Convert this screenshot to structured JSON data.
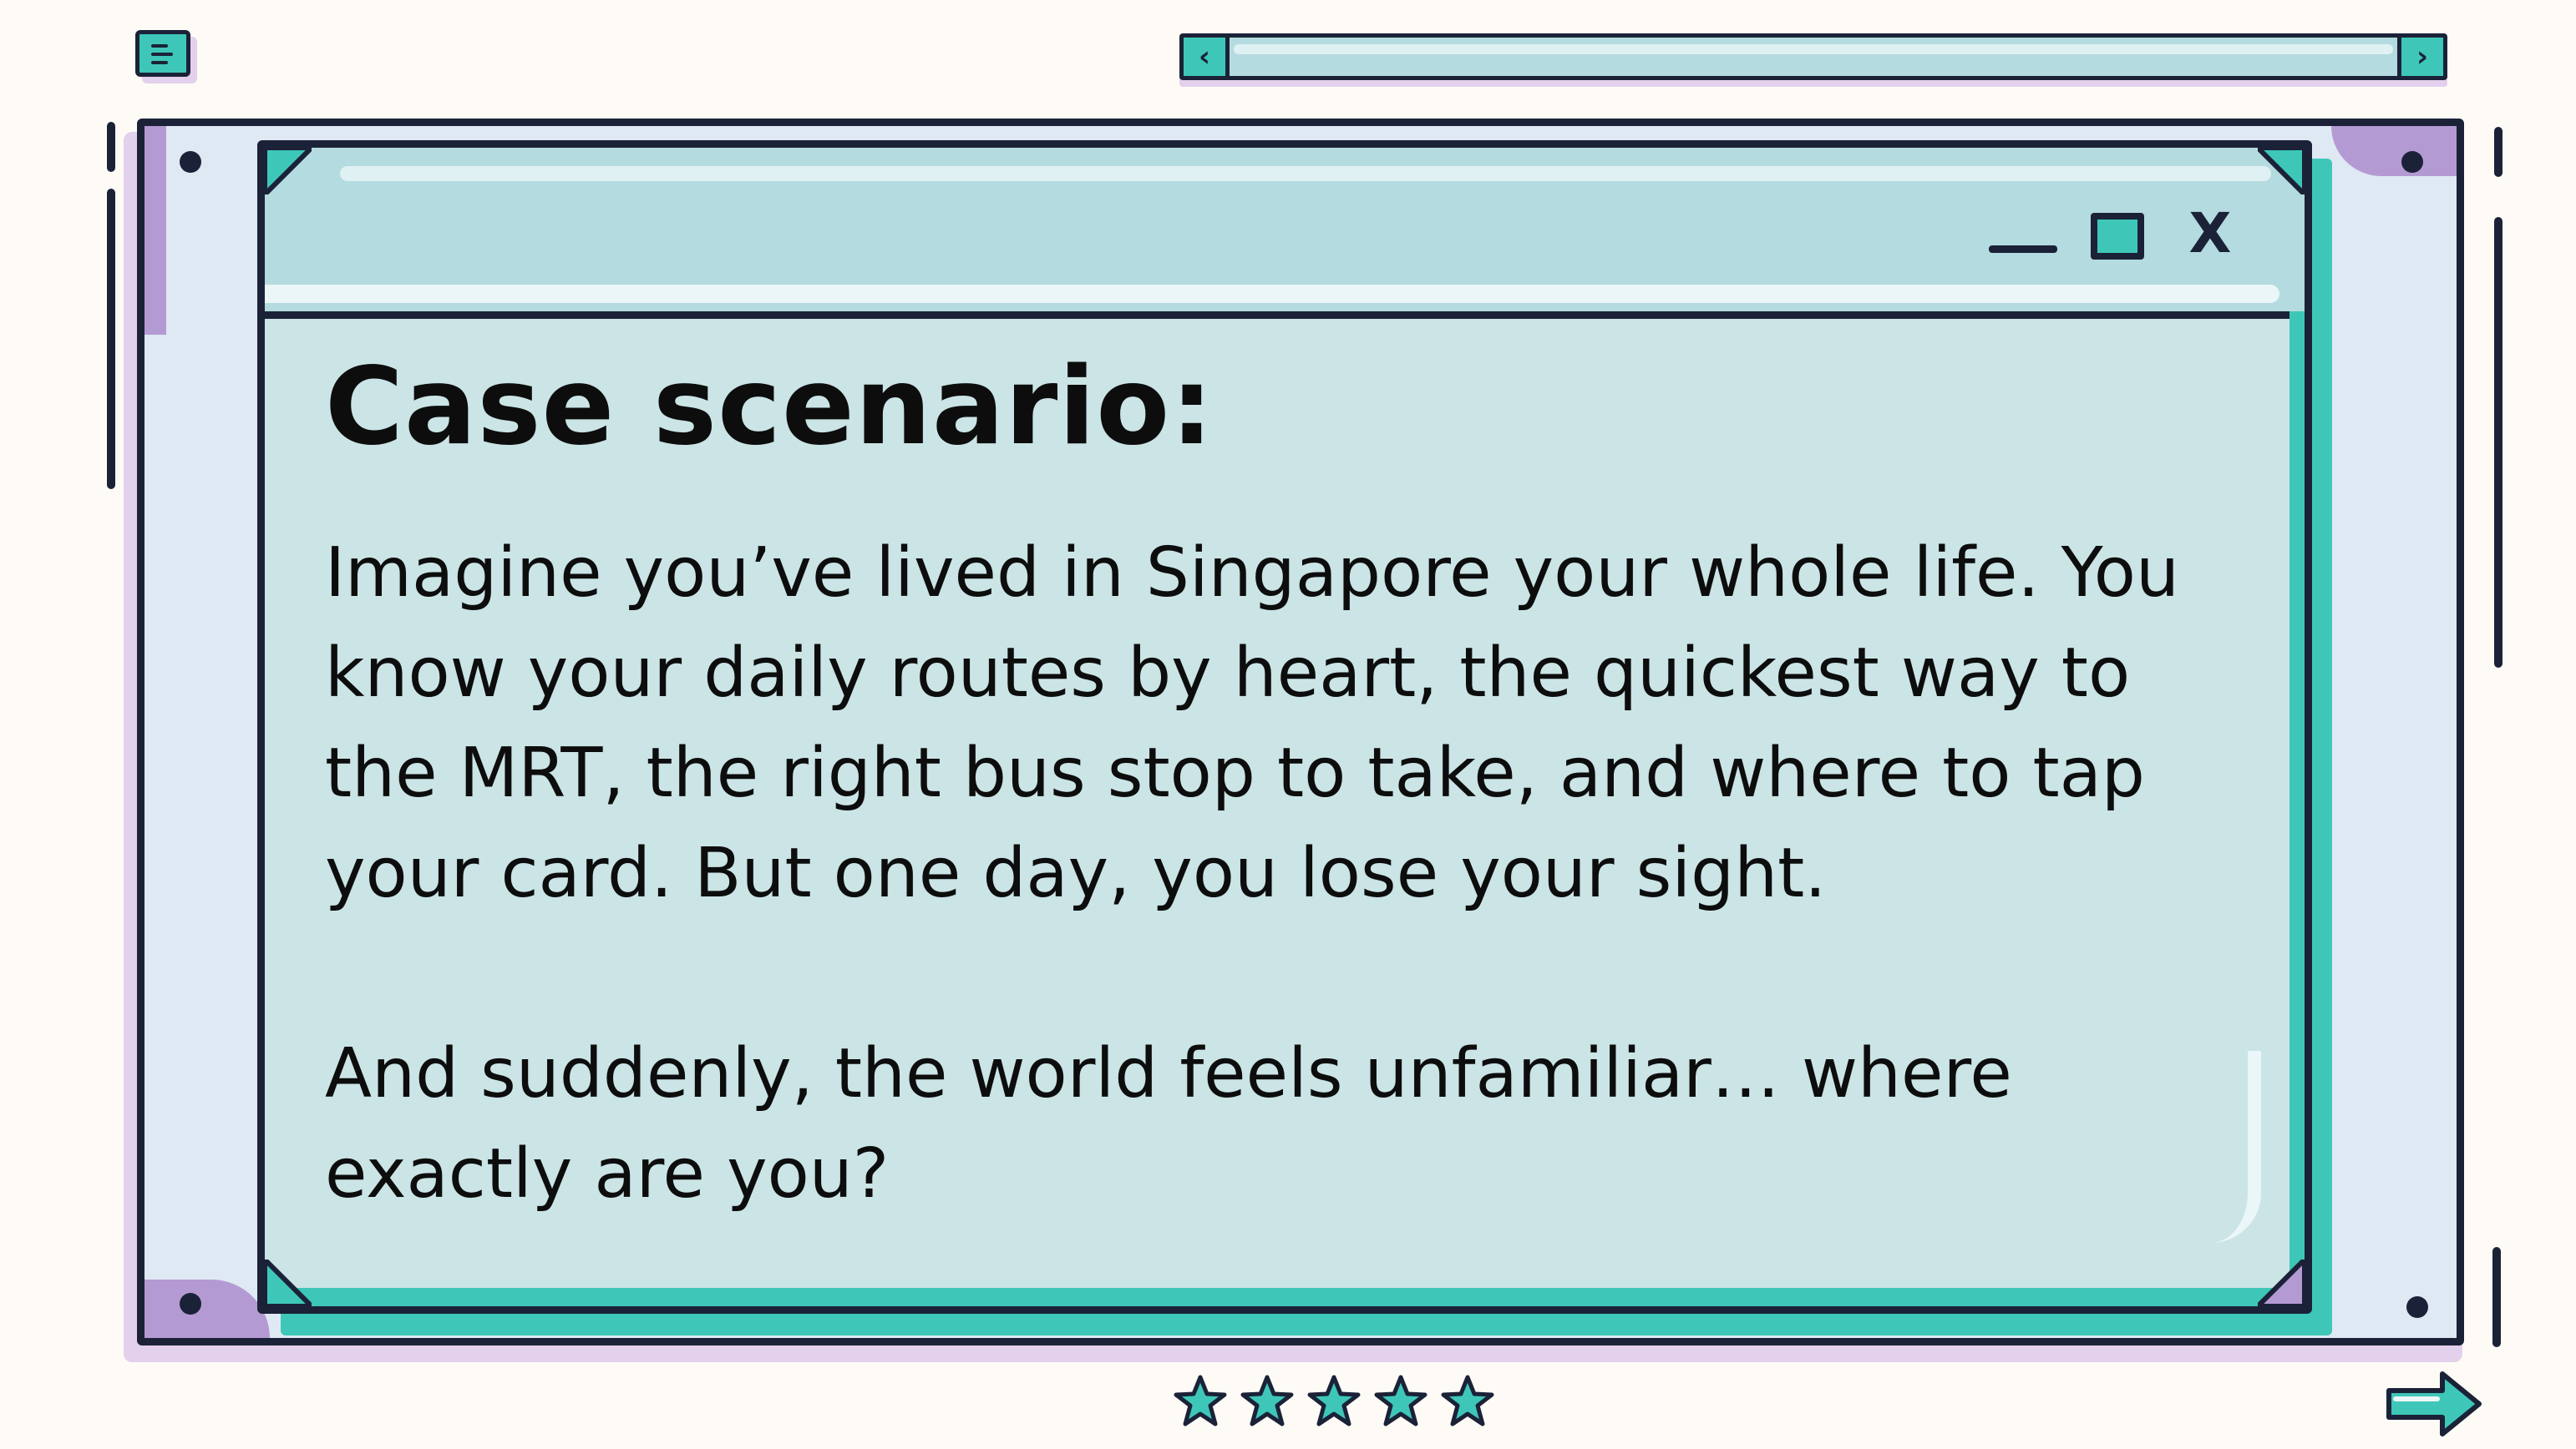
{
  "colors": {
    "background": "#fefbf6",
    "outline": "#1b2238",
    "teal_accent": "#3ec7b8",
    "window_body": "#cbe4e6",
    "titlebar": "#b4dbdf",
    "outer_frame": "#dfe9f3",
    "purple_shadow": "#b49ad2"
  },
  "icons": {
    "menu": "menu-icon",
    "scroll_left": "chevron-left-icon",
    "scroll_right": "chevron-right-icon",
    "minimize": "minimize-icon",
    "maximize": "maximize-icon",
    "close": "close-icon",
    "rating": "star-icon",
    "next": "arrow-right-icon"
  },
  "top_scrollbar": {
    "left_arrow": "‹",
    "right_arrow": "›"
  },
  "window": {
    "close_glyph": "X",
    "title": "Case scenario:",
    "paragraphs": [
      {
        "lines": [
          "Imagine you’ve lived in Singapore your whole life. You",
          "know your daily routes by heart, the quickest way to",
          "the MRT, the right bus stop to take, and where to tap",
          "your card. But one day, you lose your sight."
        ]
      },
      {
        "lines": [
          "And suddenly, the world feels unfamiliar… where",
          "exactly are you?"
        ]
      }
    ]
  },
  "rating": {
    "stars_filled": 5,
    "stars_total": 5
  }
}
